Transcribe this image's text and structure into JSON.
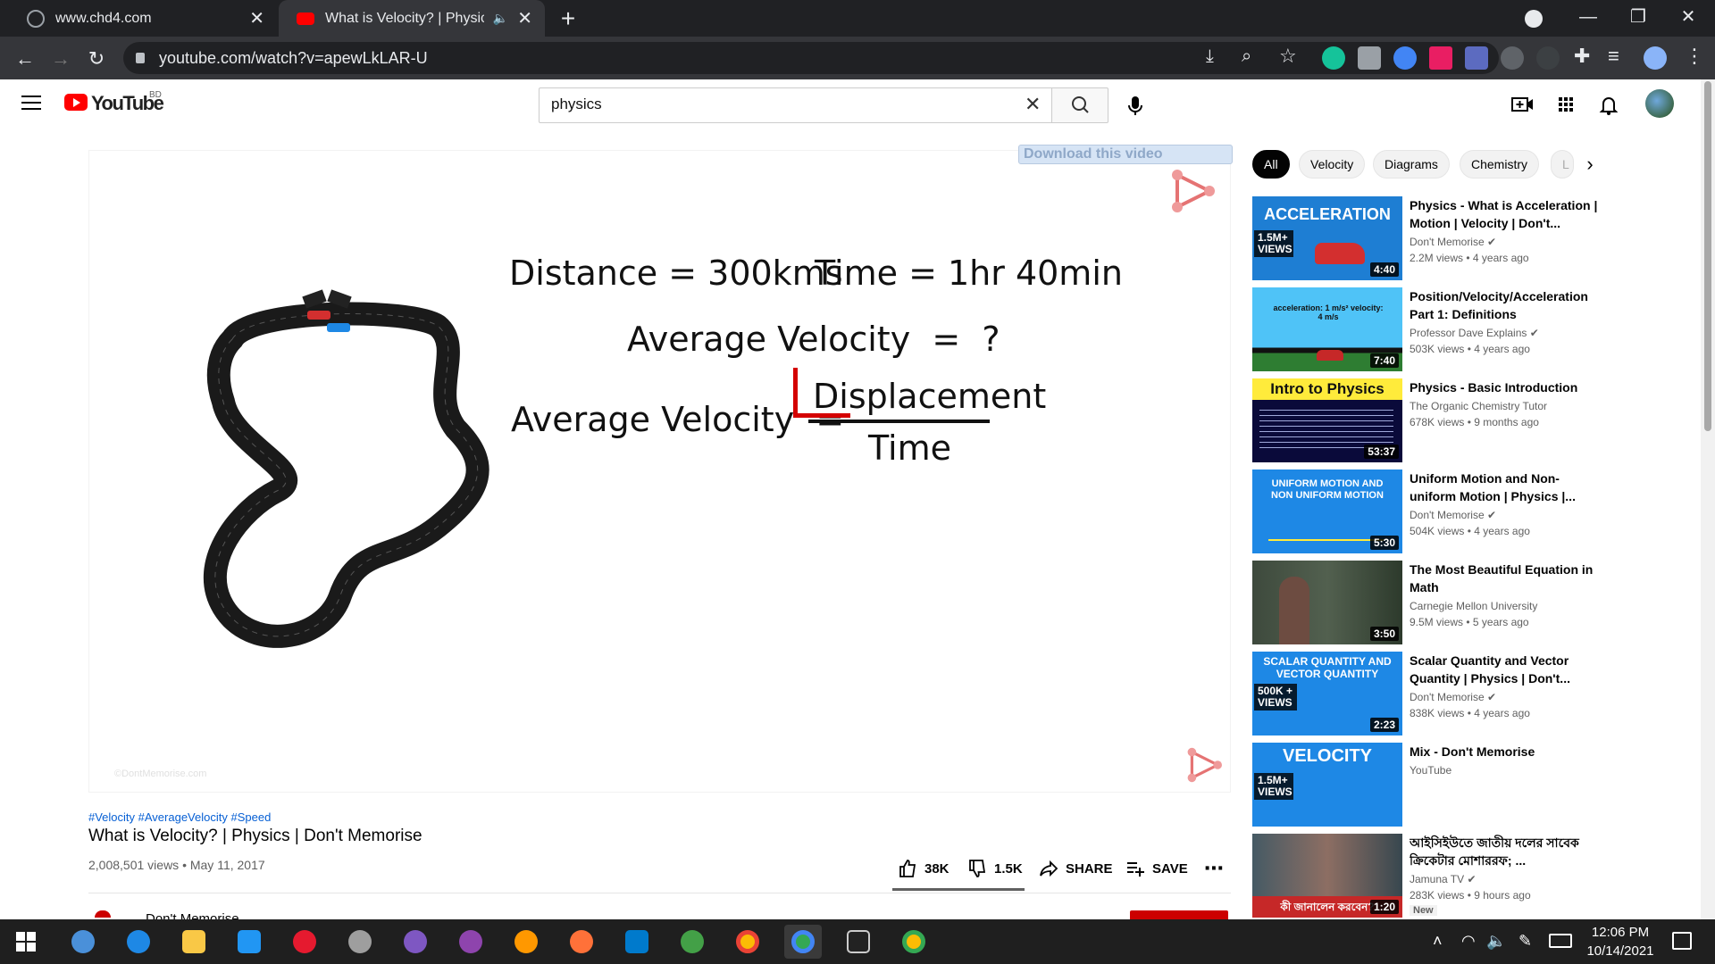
{
  "browser": {
    "tabs": [
      {
        "label": "www.chd4.com",
        "active": false
      },
      {
        "label": "What is Velocity? | Physics | D",
        "active": true
      }
    ],
    "url": "youtube.com/watch?v=apewLkLAR-U"
  },
  "youtube": {
    "country_code": "BD",
    "logo_text": "YouTube",
    "search": {
      "value": "physics"
    }
  },
  "player": {
    "download_bar": "Download this video",
    "equations": {
      "line1_left": "Distance = 300kms",
      "line1_right": "Time = 1hr 40min",
      "line2": "Average Velocity  =  ?",
      "line3_left": "Average Velocity  =",
      "numerator": "Displacement",
      "denominator": "Time"
    },
    "watermark": "©DontMemorise.com"
  },
  "video": {
    "hashtags": "#Velocity #AverageVelocity #Speed",
    "title": "What is Velocity? | Physics | Don't Memorise",
    "meta": "2,008,501 views • May 11, 2017",
    "likes": "38K",
    "dislikes": "1.5K",
    "share_label": "SHARE",
    "save_label": "SAVE",
    "like_ratio": 1.0,
    "channel_peek": "Don't Memorise"
  },
  "chips": [
    "All",
    "Velocity",
    "Diagrams",
    "Chemistry",
    "L"
  ],
  "recommendations": [
    {
      "title": "Physics - What is Acceleration | Motion | Velocity | Don't...",
      "channel": "Don't Memorise",
      "verified": true,
      "meta": "2.2M views • 4 years ago",
      "duration": "4:40",
      "thumb_text": "ACCELERATION",
      "badge": "1.5M+ VIEWS"
    },
    {
      "title": "Position/Velocity/Acceleration Part 1: Definitions",
      "channel": "Professor Dave Explains",
      "verified": true,
      "meta": "503K views • 4 years ago",
      "duration": "7:40",
      "thumb_text": "acceleration: 1 m/s²   velocity: 4 m/s"
    },
    {
      "title": "Physics - Basic Introduction",
      "channel": "The Organic Chemistry Tutor",
      "verified": false,
      "meta": "678K views • 9 months ago",
      "duration": "53:37",
      "thumb_text": "Intro to Physics"
    },
    {
      "title": "Uniform Motion and Non-uniform Motion | Physics |...",
      "channel": "Don't Memorise",
      "verified": true,
      "meta": "504K views • 4 years ago",
      "duration": "5:30",
      "thumb_text": "UNIFORM MOTION AND NON UNIFORM MOTION"
    },
    {
      "title": "The Most Beautiful Equation in Math",
      "channel": "Carnegie Mellon University",
      "verified": false,
      "meta": "9.5M views • 5 years ago",
      "duration": "3:50"
    },
    {
      "title": "Scalar Quantity and Vector Quantity | Physics | Don't...",
      "channel": "Don't Memorise",
      "verified": true,
      "meta": "838K views • 4 years ago",
      "duration": "2:23",
      "thumb_text": "SCALAR QUANTITY AND VECTOR QUANTITY",
      "badge": "500K + VIEWS"
    },
    {
      "title": "Mix - Don't Memorise",
      "channel": "YouTube",
      "verified": false,
      "meta": "",
      "duration": "",
      "thumb_text": "VELOCITY",
      "badge": "1.5M+ VIEWS"
    },
    {
      "title": "আইসিইউতে জাতীয় দলের সাবেক ক্রিকেটার মোশাররফ; ...",
      "channel": "Jamuna TV",
      "verified": true,
      "meta": "283K views • 9 hours ago",
      "duration": "1:20",
      "badge_new": "New",
      "thumb_text": "কী জানালেন করবেন?"
    }
  ],
  "taskbar": {
    "time": "12:06 PM",
    "date": "10/14/2021"
  },
  "colors": {
    "youtube_red": "#ff0000",
    "link_blue": "#065fd4",
    "chrome_dark": "#202124"
  }
}
